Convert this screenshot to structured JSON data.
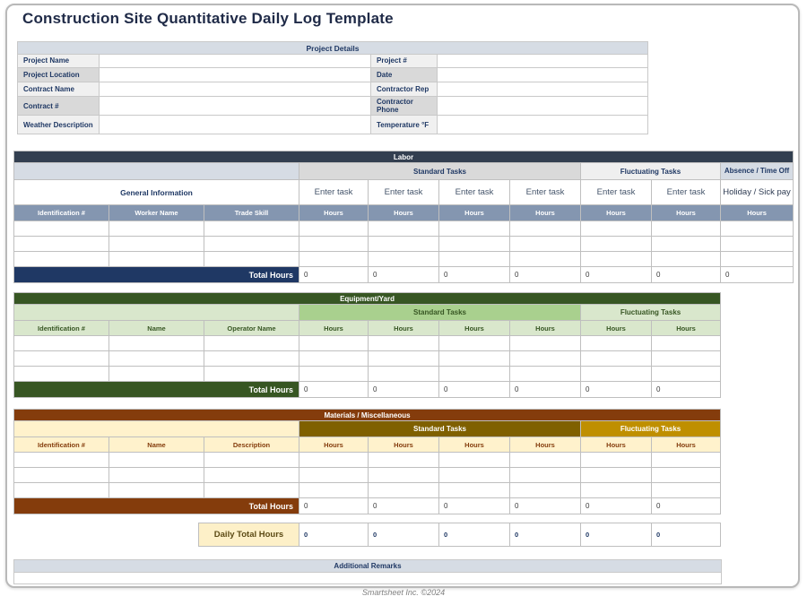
{
  "title": "Construction Site Quantitative Daily Log Template",
  "footer": "Smartsheet Inc. ©2024",
  "colors": {
    "labor_band": "#333F50",
    "labor_total": "#1F3864",
    "labor_column_header": "#8496B0",
    "light_blue": "#D6DCE4",
    "standard_gray": "#D9D9D9",
    "fluctuating_gray": "#EFEFEF",
    "green_dark": "#375623",
    "green_mid": "#A9D08E",
    "green_light": "#D9E7CC",
    "brown": "#843C0C",
    "olive": "#7F6000",
    "gold": "#BF8F00",
    "cream": "#FFF2CC"
  },
  "project_details": {
    "header": "Project Details",
    "rows": [
      {
        "l": "Project Name",
        "lv": "",
        "r": "Project #",
        "rv": ""
      },
      {
        "l": "Project Location",
        "lv": "",
        "r": "Date",
        "rv": ""
      },
      {
        "l": "Contract Name",
        "lv": "",
        "r": "Contractor Rep",
        "rv": ""
      },
      {
        "l": "Contract #",
        "lv": "",
        "r": "Contractor Phone",
        "rv": ""
      },
      {
        "l": "Weather Description",
        "lv": "",
        "r": "Temperature °F",
        "rv": ""
      }
    ]
  },
  "labor": {
    "title": "Labor",
    "general_group": "General Information",
    "standard_group": "Standard Tasks",
    "fluctuating_group": "Fluctuating Tasks",
    "absence_group": "Absence / Time Off",
    "enter_task": "Enter task",
    "absence_task": "Holiday / Sick pay",
    "columns": [
      "Identification #",
      "Worker Name",
      "Trade Skill"
    ],
    "hours_label": "Hours",
    "total_label": "Total Hours",
    "totals": [
      "0",
      "0",
      "0",
      "0",
      "0",
      "0",
      "0"
    ]
  },
  "equipment": {
    "title": "Equipment/Yard",
    "standard_group": "Standard Tasks",
    "fluctuating_group": "Fluctuating Tasks",
    "columns": [
      "Identification #",
      "Name",
      "Operator Name"
    ],
    "hours_label": "Hours",
    "total_label": "Total Hours",
    "totals": [
      "0",
      "0",
      "0",
      "0",
      "0",
      "0"
    ]
  },
  "materials": {
    "title": "Materials / Miscellaneous",
    "standard_group": "Standard Tasks",
    "fluctuating_group": "Fluctuating Tasks",
    "columns": [
      "Identification #",
      "Name",
      "Description"
    ],
    "hours_label": "Hours",
    "total_label": "Total Hours",
    "totals": [
      "0",
      "0",
      "0",
      "0",
      "0",
      "0"
    ]
  },
  "daily_total": {
    "label": "Daily Total Hours",
    "values": [
      "0",
      "0",
      "0",
      "0",
      "0",
      "0"
    ]
  },
  "remarks": {
    "header": "Additional Remarks",
    "value": ""
  }
}
